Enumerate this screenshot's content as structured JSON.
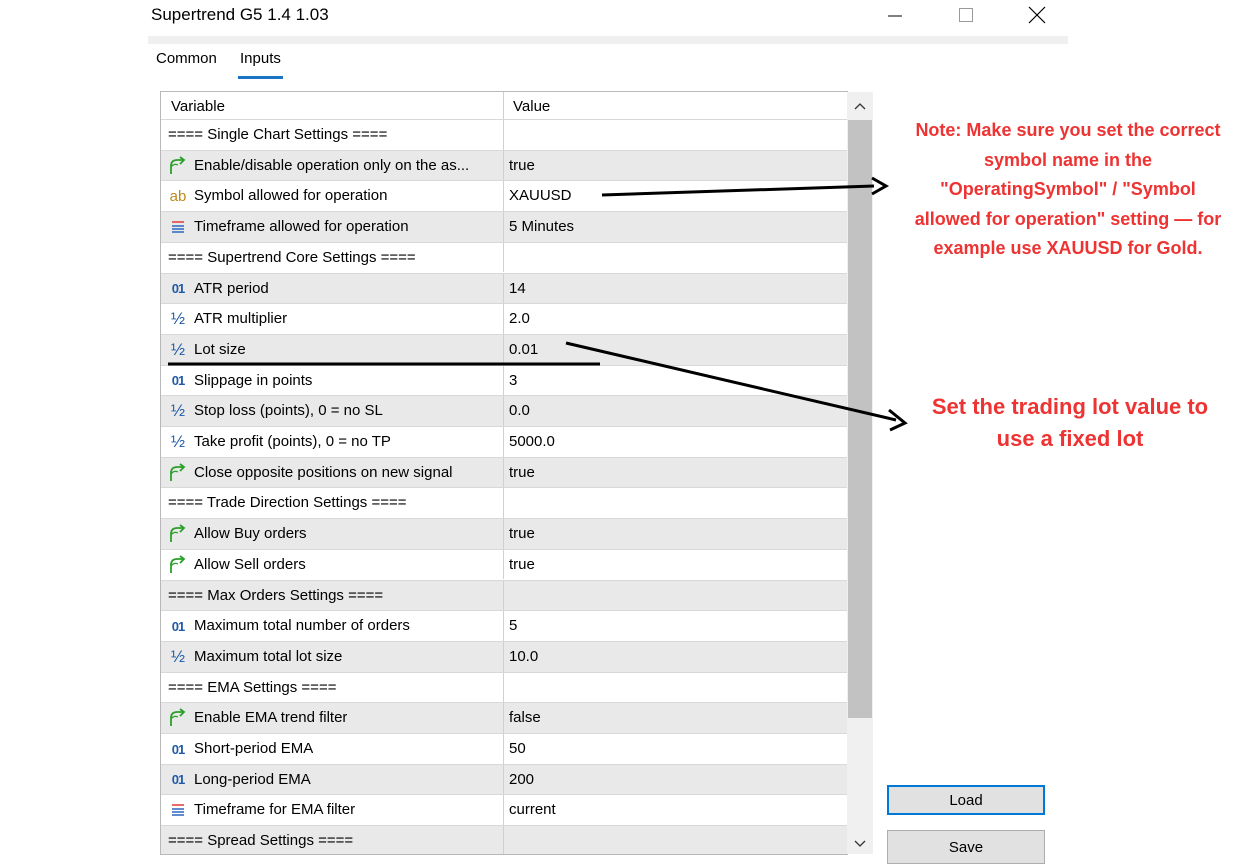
{
  "window": {
    "title": "Supertrend G5 1.4 1.03"
  },
  "tabs": [
    {
      "label": "Common",
      "active": false
    },
    {
      "label": "Inputs",
      "active": true
    }
  ],
  "table": {
    "headers": [
      "Variable",
      "Value"
    ],
    "rows": [
      {
        "icon": "none",
        "name": "==== Single Chart Settings ====",
        "value": "",
        "section": true
      },
      {
        "icon": "bool-arrow-icon",
        "name": "Enable/disable operation only on the as...",
        "value": "true"
      },
      {
        "icon": "string-icon",
        "name": "Symbol allowed for operation",
        "value": "XAUUSD"
      },
      {
        "icon": "enum-list-icon",
        "name": "Timeframe allowed for operation",
        "value": "5 Minutes"
      },
      {
        "icon": "none",
        "name": "==== Supertrend Core Settings ====",
        "value": "",
        "section": true
      },
      {
        "icon": "integer-icon",
        "name": "ATR period",
        "value": "14"
      },
      {
        "icon": "fraction-icon",
        "name": "ATR multiplier",
        "value": "2.0"
      },
      {
        "icon": "fraction-icon",
        "name": "Lot size",
        "value": "0.01"
      },
      {
        "icon": "integer-icon",
        "name": "Slippage in points",
        "value": "3"
      },
      {
        "icon": "fraction-icon",
        "name": "Stop loss (points), 0 = no SL",
        "value": "0.0"
      },
      {
        "icon": "fraction-icon",
        "name": "Take profit (points), 0 = no TP",
        "value": "5000.0"
      },
      {
        "icon": "bool-arrow-icon",
        "name": "Close opposite positions on new signal",
        "value": "true"
      },
      {
        "icon": "none",
        "name": "==== Trade Direction Settings ====",
        "value": "",
        "section": true
      },
      {
        "icon": "bool-arrow-icon",
        "name": "Allow Buy orders",
        "value": "true"
      },
      {
        "icon": "bool-arrow-icon",
        "name": "Allow Sell orders",
        "value": "true"
      },
      {
        "icon": "none",
        "name": "==== Max Orders Settings ====",
        "value": "",
        "section": true
      },
      {
        "icon": "integer-icon",
        "name": "Maximum total number of orders",
        "value": "5"
      },
      {
        "icon": "fraction-icon",
        "name": "Maximum total lot size",
        "value": "10.0"
      },
      {
        "icon": "none",
        "name": "==== EMA Settings ====",
        "value": "",
        "section": true
      },
      {
        "icon": "bool-arrow-icon",
        "name": "Enable EMA trend filter",
        "value": "false"
      },
      {
        "icon": "integer-icon",
        "name": "Short-period EMA",
        "value": "50"
      },
      {
        "icon": "integer-icon",
        "name": "Long-period EMA",
        "value": "200"
      },
      {
        "icon": "enum-list-icon",
        "name": "Timeframe for EMA filter",
        "value": "current"
      },
      {
        "icon": "none",
        "name": "==== Spread Settings ====",
        "value": "",
        "section": true
      }
    ]
  },
  "buttons": {
    "load": "Load",
    "save": "Save"
  },
  "annotations": {
    "note_symbol": [
      "Note: Make sure you set the correct",
      "symbol name in the",
      "\"OperatingSymbol\" / \"Symbol",
      "allowed for operation\" setting — for",
      "example use XAUUSD for Gold."
    ],
    "note_lot": [
      "Set the trading lot value to",
      "use a fixed lot"
    ]
  },
  "colors": {
    "annotation_red": "#ee3333",
    "tab_underline": "#1a73c5",
    "focus_border": "#0078d7",
    "bool_icon": "#2aa02a",
    "type_icon": "#1e5aa8"
  }
}
